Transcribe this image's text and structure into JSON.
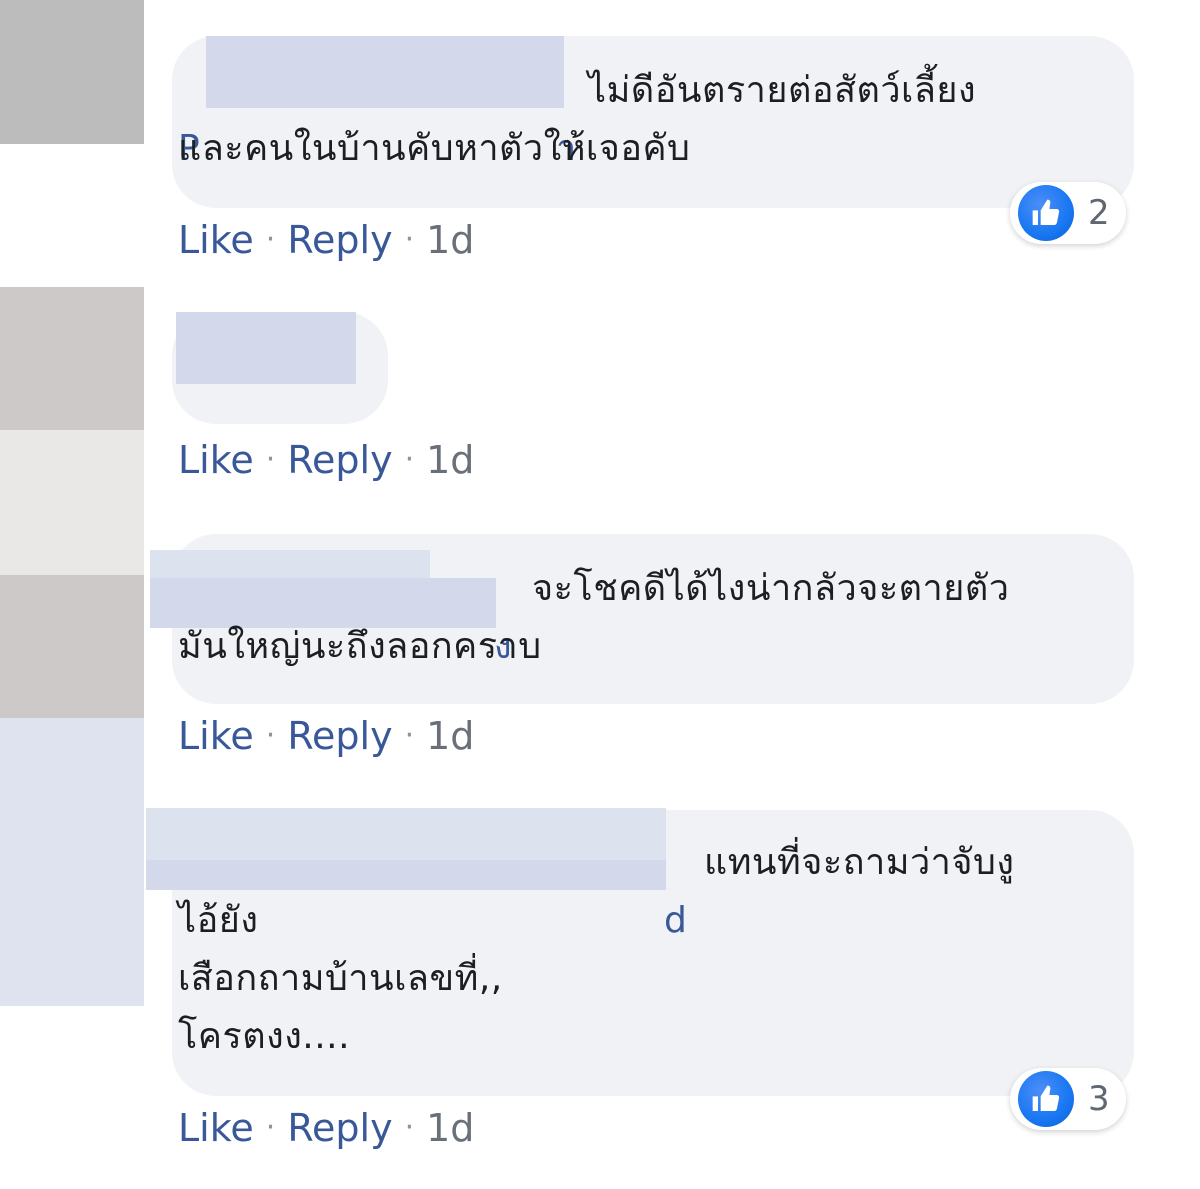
{
  "comments": [
    {
      "author_visible": "P",
      "author_tail": "า",
      "text": "ไม่ดีอันตรายต่อสัตว์เลี้ยง\nและคนในบ้านคับหาตัวให้เจอคับ",
      "reaction_count": "2",
      "actions": {
        "like": "Like",
        "reply": "Reply",
        "time": "1d"
      }
    },
    {
      "actions": {
        "like": "Like",
        "reply": "Reply",
        "time": "1d"
      }
    },
    {
      "author_tail": "ง",
      "text": "จะโชคดีได้ไงน่ากลัวจะตายตัว\nมันใหญ่นะถึงลอกคราบ",
      "actions": {
        "like": "Like",
        "reply": "Reply",
        "time": "1d"
      }
    },
    {
      "author_tail": "d",
      "text": "แทนที่จะถามว่าจับงู\nไอ้ยัง\nเสือกถามบ้านเลขที่,,\nโครตงง....",
      "reaction_count": "3",
      "actions": {
        "like": "Like",
        "reply": "Reply",
        "time": "1d"
      }
    }
  ],
  "separator": "·",
  "icons": {
    "reaction": "like-reaction-icon"
  },
  "colors": {
    "bubble": "#f0f2f5",
    "link": "#385898",
    "like_blue": "#1877f2",
    "redaction": "#d3d9ea"
  }
}
